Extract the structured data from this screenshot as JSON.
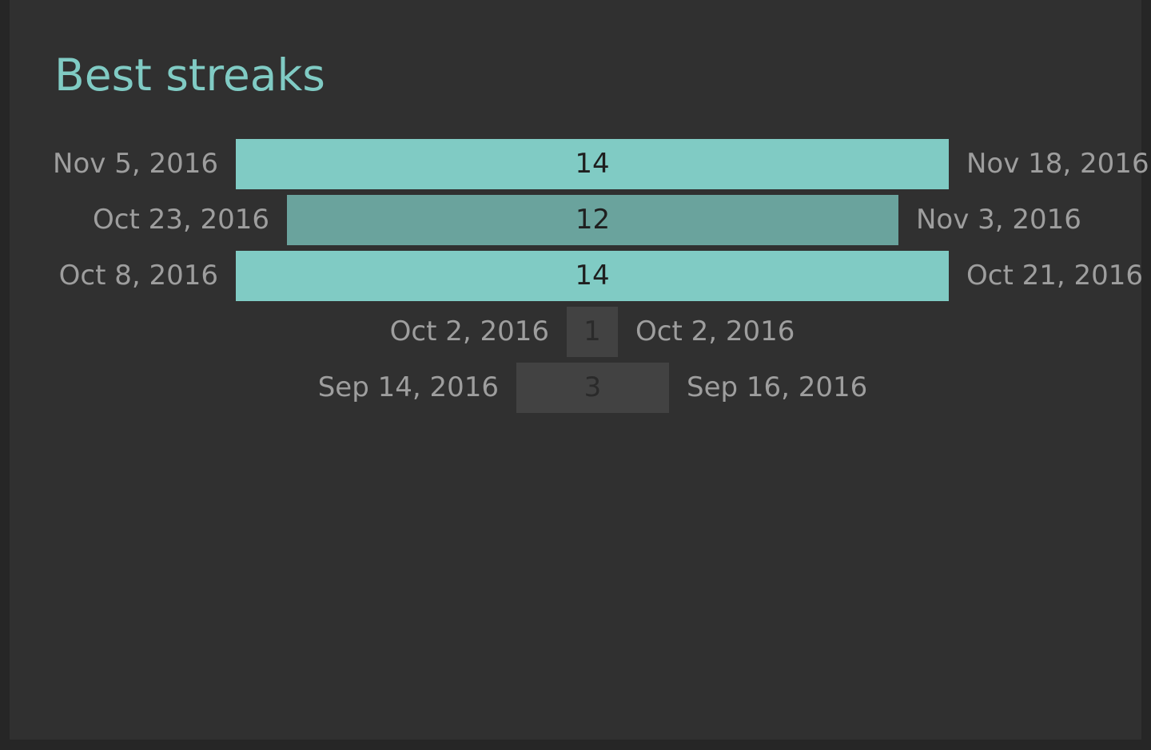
{
  "title": "Best streaks",
  "colors": {
    "background": "#303030",
    "accent": "#80cbc4",
    "bar_top": "#80cbc4",
    "bar_mid": "#6aa39d",
    "bar_low": "#424242",
    "date_text": "#9e9e9e"
  },
  "streaks": [
    {
      "start": "Nov 5, 2016",
      "end": "Nov 18, 2016",
      "length": 14,
      "label": "14",
      "level": "top"
    },
    {
      "start": "Oct 23, 2016",
      "end": "Nov 3, 2016",
      "length": 12,
      "label": "12",
      "level": "mid"
    },
    {
      "start": "Oct 8, 2016",
      "end": "Oct 21, 2016",
      "length": 14,
      "label": "14",
      "level": "top"
    },
    {
      "start": "Oct 2, 2016",
      "end": "Oct 2, 2016",
      "length": 1,
      "label": "1",
      "level": "low"
    },
    {
      "start": "Sep 14, 2016",
      "end": "Sep 16, 2016",
      "length": 3,
      "label": "3",
      "level": "low"
    }
  ]
}
